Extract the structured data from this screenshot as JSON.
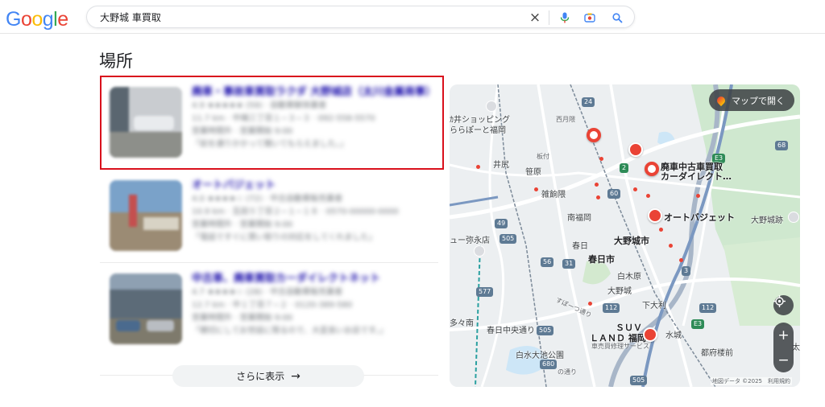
{
  "header": {
    "logo_letters": [
      "G",
      "o",
      "o",
      "g",
      "l",
      "e"
    ],
    "search_query": "大野城 車買取",
    "clear_icon": "×"
  },
  "section": {
    "title": "場所"
  },
  "places": [
    {
      "name": "廃車・事故車買取ラクダ 大野城店（太川金属商事）",
      "rating_line": "4.9 ★★★★★ (59) · 自動車解体業者",
      "address_line": "11.7 km · 中端三丁目１−３−３ · 092-558-5570",
      "status_line": "営業時間外 · 営業開始 9:00",
      "review": "「前を通りかかって聞いてもらえました。」",
      "thumb_colors": [
        "#5a6670",
        "#c9ccd0",
        "#8d8f8a"
      ]
    },
    {
      "name": "オートバジェット",
      "rating_line": "4.0 ★★★★☆ (72) · 中古自動車販売業者",
      "address_line": "10.9 km · 瓦田５丁目２−１−１８ · 0570-00000-0000",
      "status_line": "営業時間外 · 営業開始 9:00",
      "review": "「電話ですぐに買い取りの対応をしてくれました」",
      "thumb_colors": [
        "#7aa2c9",
        "#c44f4f",
        "#9b8b74"
      ]
    },
    {
      "name": "中古車、廃車買取カーダイレクトネット",
      "rating_line": "4.7 ★★★★☆ (28) · 中古自動車販売業者",
      "address_line": "12.7 km · 中１丁目７−２ · 0120-389-580",
      "status_line": "営業時間外 · 営業開始 9:00",
      "review": "「親切にしてお世話に限るので、大変良いお店です。」",
      "thumb_colors": [
        "#8ea0b2",
        "#5c6b78",
        "#7e7a6c"
      ]
    }
  ],
  "more_button": {
    "label": "さらに表示",
    "arrow": "→"
  },
  "map": {
    "open_label": "マップで開く",
    "attribution": "地図データ ©2025　利用規約",
    "labels": {
      "haisha": "廃車中古車買取",
      "haisha2": "カーダイレクト…",
      "auto_budget": "オートバジェット",
      "onojo_city": "大野城市",
      "kasuga": "春日",
      "kasuga_city": "春日市",
      "minamifukuoka": "南福岡",
      "zasshonokuma": "雑餉隈",
      "ijiri": "井尻",
      "sasabaru": "笹原",
      "shiraki": "白木原",
      "onojo": "大野城",
      "shimoori": "下大利",
      "mizuki": "水城",
      "tofurou": "都府楼前",
      "kasuga_chuo": "春日中央通り",
      "shiramizu": "白水大池公園",
      "tamaminami": "多々南",
      "suv": "ＳＵＶ",
      "land": "ＬＡＮＤ 福岡",
      "land_sub": "車売買修理サービス",
      "sumoku": "すぼーつ通り",
      "ikyu": "ュー弥永店",
      "onojo_ato": "大野城跡",
      "shopping": "ｶ井ショッピング",
      "lalaport": "ららぽーと福岡",
      "nishitsukihaku": "西月隈",
      "itazuke": "板付",
      "ohno_mu": "大野",
      "onomachi": "の通り",
      "dazaifu_hint": "太"
    },
    "routes": [
      "24",
      "2",
      "60",
      "112",
      "49",
      "505",
      "56",
      "31",
      "3",
      "577",
      "112",
      "505",
      "680",
      "505",
      "68",
      "E3",
      "E3"
    ]
  }
}
